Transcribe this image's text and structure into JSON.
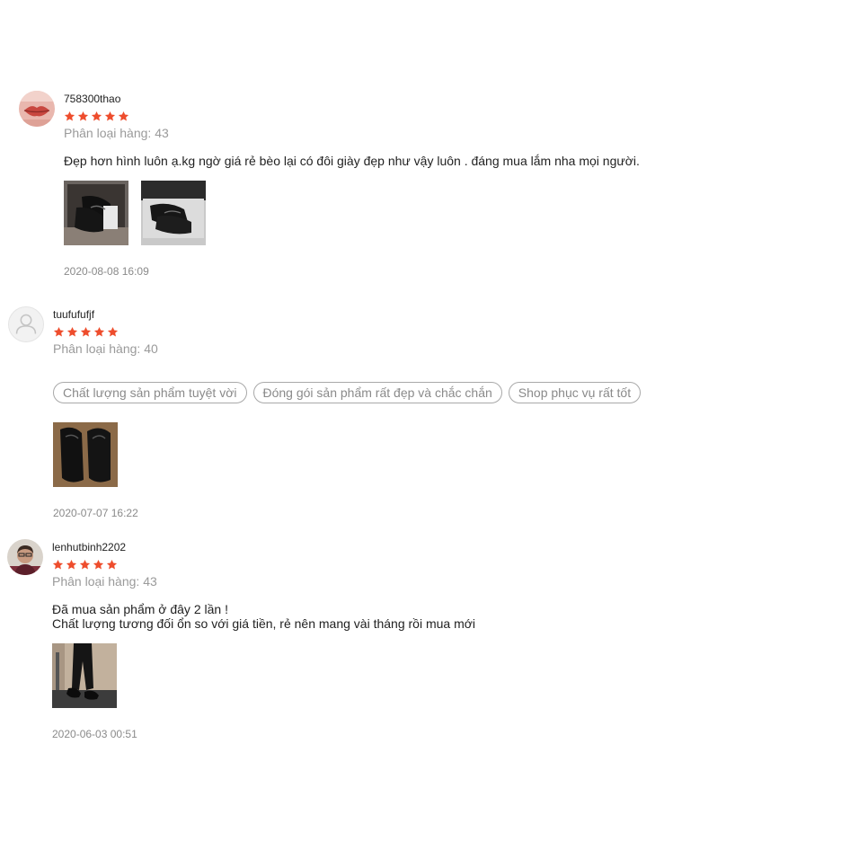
{
  "reviews": [
    {
      "username": "758300thao",
      "rating": 5,
      "variant": "Phân loại hàng: 43",
      "content_lines": [
        "Đẹp hơn hình luôn ạ.kg ngờ giá rẻ bèo lại có đôi giày đẹp như vậy luôn . đáng mua lắm nha mọi người."
      ],
      "tags": [],
      "photo_count": 2,
      "date": "2020-08-08 16:09"
    },
    {
      "username": "tuufufufjf",
      "rating": 5,
      "variant": "Phân loại hàng: 40",
      "content_lines": [],
      "tags": [
        "Chất lượng sản phẩm tuyệt vời",
        "Đóng gói sản phẩm rất đẹp và chắc chắn",
        "Shop phục vụ rất tốt"
      ],
      "photo_count": 1,
      "date": "2020-07-07 16:22"
    },
    {
      "username": "lenhutbinh2202",
      "rating": 5,
      "variant": "Phân loại hàng: 43",
      "content_lines": [
        "Đã mua sản phẩm ở đây 2 lần !",
        "Chất lượng tương đối ổn so với giá tiền, rẻ nên mang vài tháng rồi mua mới"
      ],
      "tags": [],
      "photo_count": 1,
      "date": "2020-06-03 00:51"
    }
  ],
  "colors": {
    "star": "#ee4d2d",
    "muted_text": "#9a9a9a",
    "tag_border": "#a8a8a8"
  },
  "icons": {
    "star": "star-icon",
    "default_avatar": "user-silhouette-icon"
  }
}
